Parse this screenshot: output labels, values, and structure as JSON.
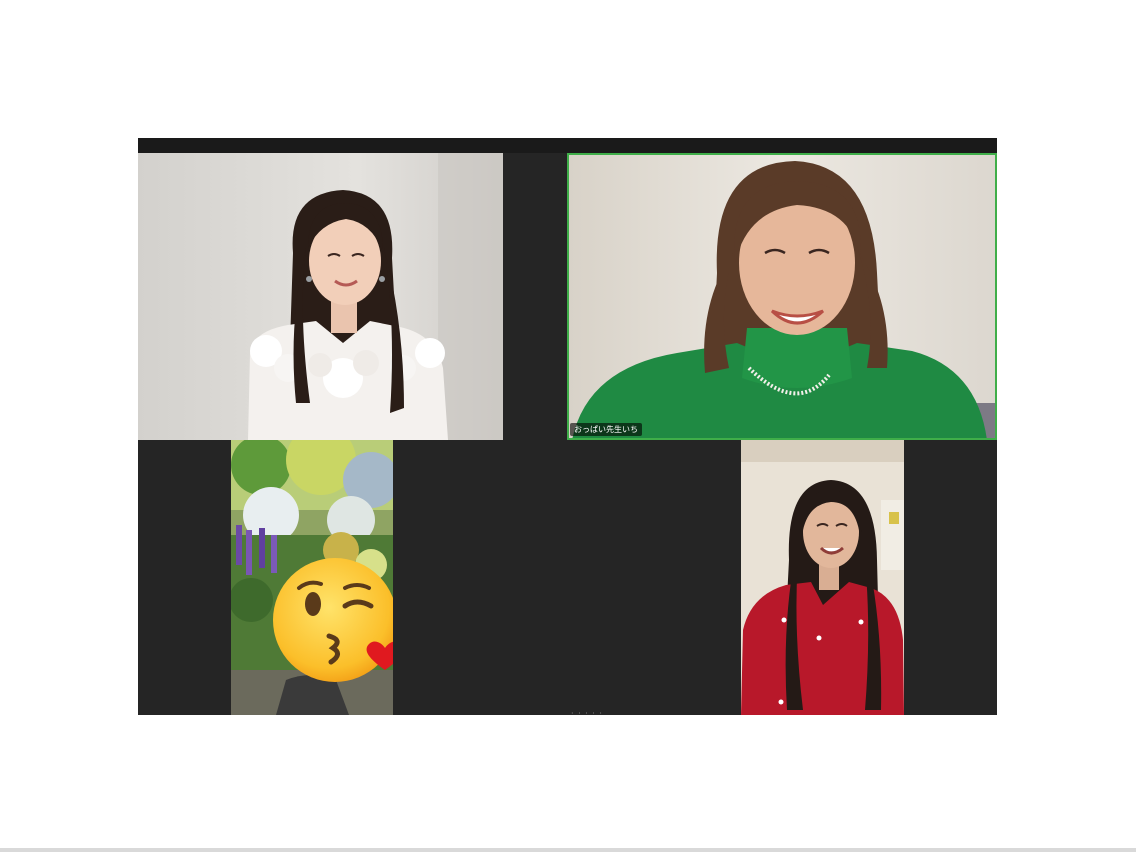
{
  "participants": [
    {
      "id": "p1",
      "name": "",
      "active_speaker": false
    },
    {
      "id": "p2",
      "name": "おっぱい先生いち",
      "active_speaker": true
    },
    {
      "id": "p3",
      "name": "",
      "active_speaker": false,
      "face_covered_by": "face-blowing-kiss-emoji"
    },
    {
      "id": "p4",
      "name": "",
      "active_speaker": false
    }
  ],
  "colors": {
    "meeting_background": "#252525",
    "active_speaker_border": "#3fae49",
    "page_background": "#ffffff"
  },
  "center_indicator": "· · · · ·"
}
